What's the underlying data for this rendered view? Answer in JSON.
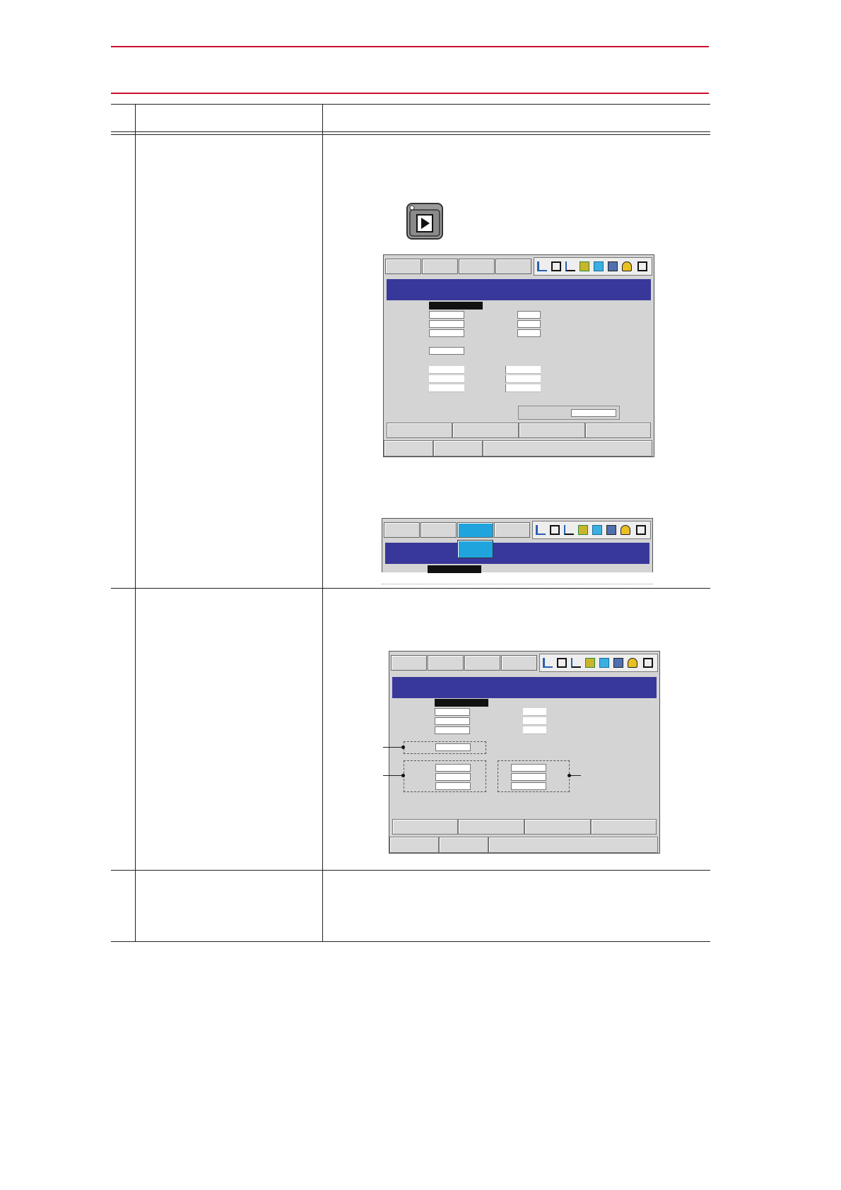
{
  "page": {
    "header_text": "",
    "table_header": {
      "col_step": "",
      "col_operation": "",
      "col_explanation": ""
    }
  },
  "icons": {
    "play_key": "play-mode-key-icon",
    "status_bar": [
      "servo-status-icon",
      "cycle-icon",
      "coordinate-icon",
      "tool-icon",
      "security-icon",
      "storage-icon",
      "sleep-icon",
      "play-mode-icon"
    ]
  },
  "colors": {
    "rule_red": "#c8102e",
    "title_bar_blue": "#38389a",
    "active_menu_cyan": "#1fa4dd",
    "screen_gray": "#d4d4d4"
  }
}
